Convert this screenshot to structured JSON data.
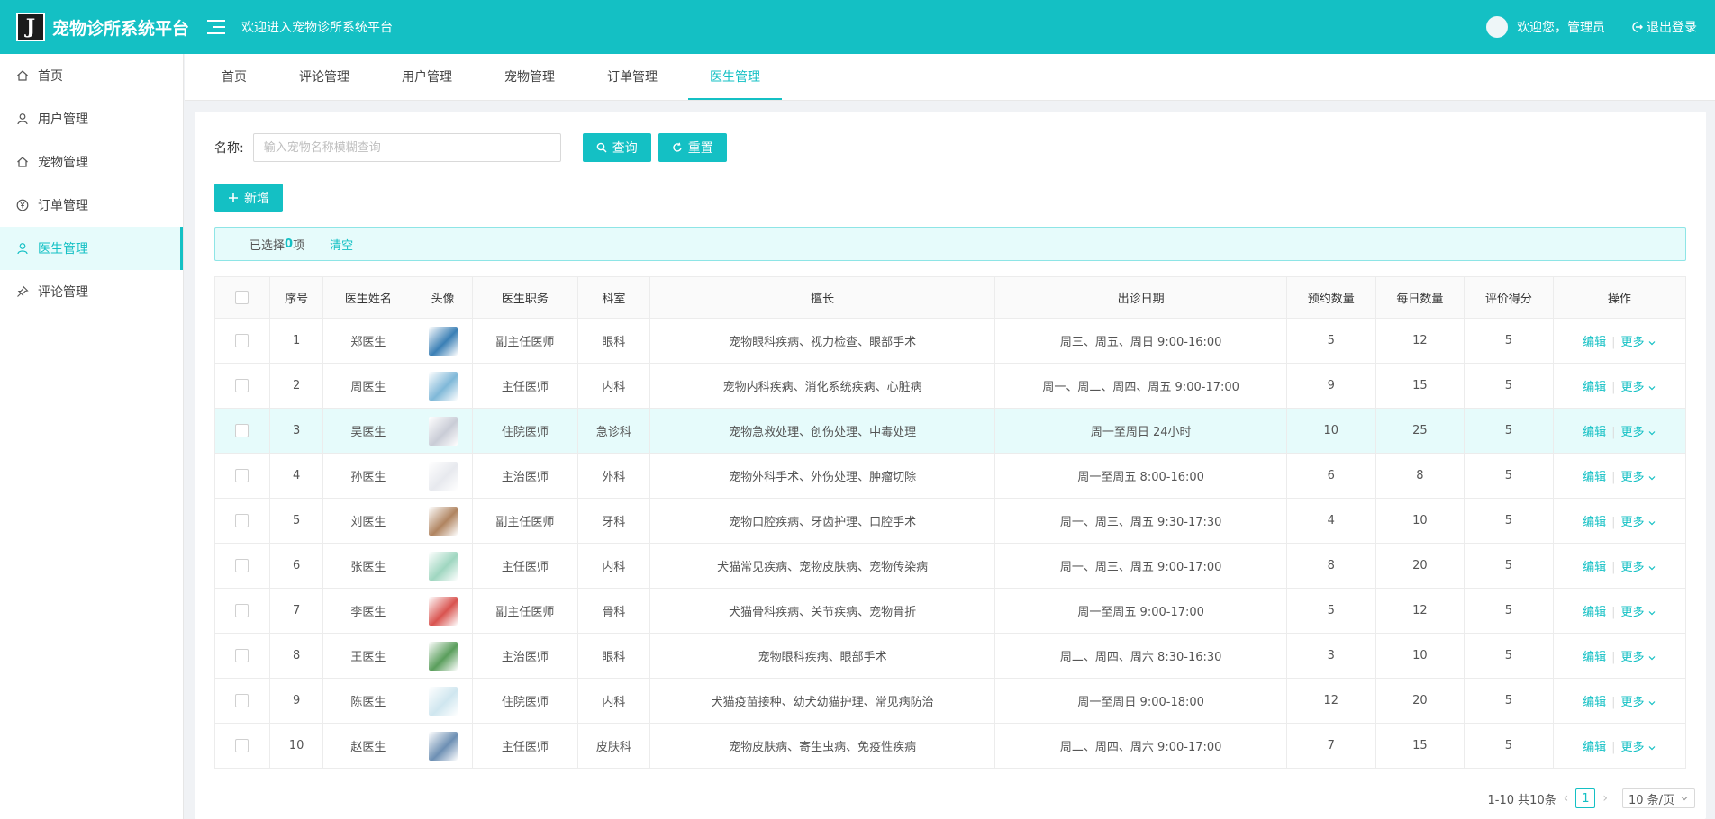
{
  "header": {
    "logo_letter": "J",
    "app_title": "宠物诊所系统平台",
    "welcome_banner": "欢迎进入宠物诊所系统平台",
    "greeting": "欢迎您，管理员",
    "logout_label": "退出登录",
    "color": "#14c0c4"
  },
  "sidebar": {
    "items": [
      {
        "label": "首页",
        "icon": "home-icon"
      },
      {
        "label": "用户管理",
        "icon": "user-icon"
      },
      {
        "label": "宠物管理",
        "icon": "home-icon"
      },
      {
        "label": "订单管理",
        "icon": "yen-circle-icon"
      },
      {
        "label": "医生管理",
        "icon": "user-icon",
        "active": true
      },
      {
        "label": "评论管理",
        "icon": "pin-icon"
      }
    ]
  },
  "tabs": [
    {
      "label": "首页"
    },
    {
      "label": "评论管理"
    },
    {
      "label": "用户管理"
    },
    {
      "label": "宠物管理"
    },
    {
      "label": "订单管理"
    },
    {
      "label": "医生管理",
      "active": true
    }
  ],
  "search": {
    "label": "名称:",
    "placeholder": "输入宠物名称模糊查询",
    "value": "",
    "query_label": "查询",
    "reset_label": "重置"
  },
  "add_label": "新增",
  "selection": {
    "prefix": "已选择",
    "count": "0",
    "suffix": "项",
    "clear_label": "清空"
  },
  "table": {
    "columns": [
      "",
      "序号",
      "医生姓名",
      "头像",
      "医生职务",
      "科室",
      "擅长",
      "出诊日期",
      "预约数量",
      "每日数量",
      "评价得分",
      "操作"
    ],
    "edit_label": "编辑",
    "more_label": "更多",
    "rows": [
      {
        "no": "1",
        "name": "郑医生",
        "title": "副主任医师",
        "dept": "眼科",
        "skill": "宠物眼科疾病、视力检查、眼部手术",
        "schedule": "周三、周五、周日 9:00-16:00",
        "booked": "5",
        "daily": "12",
        "score": "5",
        "avatar_color": "#3a7fb5"
      },
      {
        "no": "2",
        "name": "周医生",
        "title": "主任医师",
        "dept": "内科",
        "skill": "宠物内科疾病、消化系统疾病、心脏病",
        "schedule": "周一、周二、周四、周五 9:00-17:00",
        "booked": "9",
        "daily": "15",
        "score": "5",
        "avatar_color": "#7fb8d8"
      },
      {
        "no": "3",
        "name": "吴医生",
        "title": "住院医师",
        "dept": "急诊科",
        "skill": "宠物急救处理、创伤处理、中毒处理",
        "schedule": "周一至周日 24小时",
        "booked": "10",
        "daily": "25",
        "score": "5",
        "avatar_color": "#c9ccd6"
      },
      {
        "no": "4",
        "name": "孙医生",
        "title": "主治医师",
        "dept": "外科",
        "skill": "宠物外科手术、外伤处理、肿瘤切除",
        "schedule": "周一至周五 8:00-16:00",
        "booked": "6",
        "daily": "8",
        "score": "5",
        "avatar_color": "#e7e9ee"
      },
      {
        "no": "5",
        "name": "刘医生",
        "title": "副主任医师",
        "dept": "牙科",
        "skill": "宠物口腔疾病、牙齿护理、口腔手术",
        "schedule": "周一、周三、周五 9:30-17:30",
        "booked": "4",
        "daily": "10",
        "score": "5",
        "avatar_color": "#b08460"
      },
      {
        "no": "6",
        "name": "张医生",
        "title": "主任医师",
        "dept": "内科",
        "skill": "犬猫常见疾病、宠物皮肤病、宠物传染病",
        "schedule": "周一、周三、周五 9:00-17:00",
        "booked": "8",
        "daily": "20",
        "score": "5",
        "avatar_color": "#9fd6c0"
      },
      {
        "no": "7",
        "name": "李医生",
        "title": "副主任医师",
        "dept": "骨科",
        "skill": "犬猫骨科疾病、关节疾病、宠物骨折",
        "schedule": "周一至周五 9:00-17:00",
        "booked": "5",
        "daily": "12",
        "score": "5",
        "avatar_color": "#d9534f"
      },
      {
        "no": "8",
        "name": "王医生",
        "title": "主治医师",
        "dept": "眼科",
        "skill": "宠物眼科疾病、眼部手术",
        "schedule": "周二、周四、周六 8:30-16:30",
        "booked": "3",
        "daily": "10",
        "score": "5",
        "avatar_color": "#5a9e5c"
      },
      {
        "no": "9",
        "name": "陈医生",
        "title": "住院医师",
        "dept": "内科",
        "skill": "犬猫疫苗接种、幼犬幼猫护理、常见病防治",
        "schedule": "周一至周日 9:00-18:00",
        "booked": "12",
        "daily": "20",
        "score": "5",
        "avatar_color": "#cfe6ef"
      },
      {
        "no": "10",
        "name": "赵医生",
        "title": "主任医师",
        "dept": "皮肤科",
        "skill": "宠物皮肤病、寄生虫病、免疫性疾病",
        "schedule": "周二、周四、周六 9:00-17:00",
        "booked": "7",
        "daily": "15",
        "score": "5",
        "avatar_color": "#6d8fb3"
      }
    ]
  },
  "pagination": {
    "total_text": "1-10 共10条",
    "current_page": "1",
    "page_size": "10 条/页"
  }
}
